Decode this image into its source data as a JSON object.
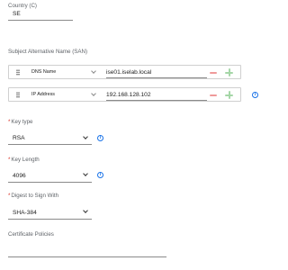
{
  "country": {
    "label": "Country (C)",
    "value": "SE"
  },
  "san": {
    "label": "Subject Alternative Name (SAN)",
    "rows": [
      {
        "type": "DNS Name",
        "value": "ise01.iselab.local"
      },
      {
        "type": "IP Address",
        "value": "192.168.128.102"
      }
    ]
  },
  "key_type": {
    "label": "Key type",
    "value": "RSA"
  },
  "key_length": {
    "label": "Key Length",
    "value": "4096"
  },
  "digest": {
    "label": "Digest to Sign With",
    "value": "SHA-384"
  },
  "cert_policies": {
    "label": "Certificate Policies",
    "value": ""
  },
  "required_marker": "*",
  "info_glyph": "i",
  "colors": {
    "info": "#1a73e8",
    "remove": "#ef9a9a",
    "add": "#a5d6a7",
    "required": "#d93025"
  }
}
